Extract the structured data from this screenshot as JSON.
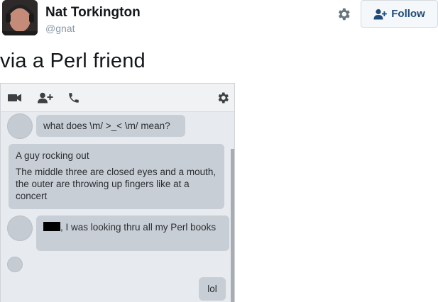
{
  "tweet": {
    "author_name": "Nat Torkington",
    "author_handle": "@gnat",
    "follow_label": "Follow",
    "text": "via a Perl friend"
  },
  "screenshot": {
    "toolbar_icons": [
      "video-camera-icon",
      "add-person-icon",
      "phone-icon",
      "gear-icon"
    ],
    "messages": [
      {
        "side": "left",
        "lines": [
          "what does \\m/ >_< \\m/ mean?"
        ]
      },
      {
        "side": "left",
        "lines": [
          "A guy rocking out",
          "The middle three are closed eyes and a mouth, the outer are throwing up fingers like at a concert"
        ]
      },
      {
        "side": "left",
        "lines": [
          ", I was looking thru all my Perl books"
        ],
        "redacted_prefix": true
      },
      {
        "side": "right",
        "lines": [
          "lol"
        ]
      }
    ]
  },
  "colors": {
    "follow_text": "#1e4b7a",
    "bubble": "#c8ced5",
    "chat_background": "#e7eaee"
  }
}
